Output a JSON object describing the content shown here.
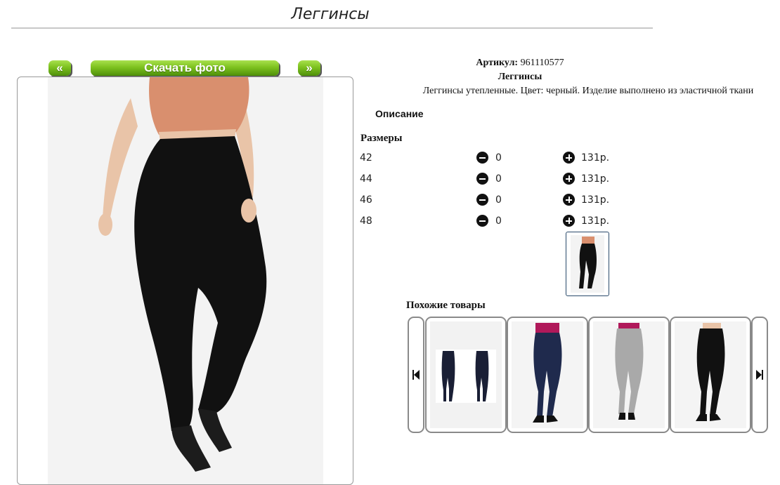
{
  "page": {
    "title": "Леггинсы"
  },
  "gallery": {
    "prev_label": "«",
    "download_label": "Скачать фото",
    "next_label": "»"
  },
  "product": {
    "article_label": "Артикул:",
    "article_value": "961110577",
    "name": "Леггинсы",
    "description_text": "Леггинсы утепленные. Цвет: черный. Изделие выполнено из эластичной ткани",
    "description_heading": "Описание",
    "sizes_heading": "Размеры"
  },
  "sizes": [
    {
      "size": "42",
      "qty": "0",
      "price": "131р."
    },
    {
      "size": "44",
      "qty": "0",
      "price": "131р."
    },
    {
      "size": "46",
      "qty": "0",
      "price": "131р."
    },
    {
      "size": "48",
      "qty": "0",
      "price": "131р."
    }
  ],
  "similar": {
    "heading": "Похожие товары"
  },
  "colors": {
    "button_top": "#a9e04e",
    "button_bottom": "#4e8f0a",
    "legging_black": "#111111",
    "legging_navy": "#1f2a4d",
    "legging_grey": "#a9a9a9",
    "top_tan": "#d98f6e",
    "top_magenta": "#b0195a"
  }
}
